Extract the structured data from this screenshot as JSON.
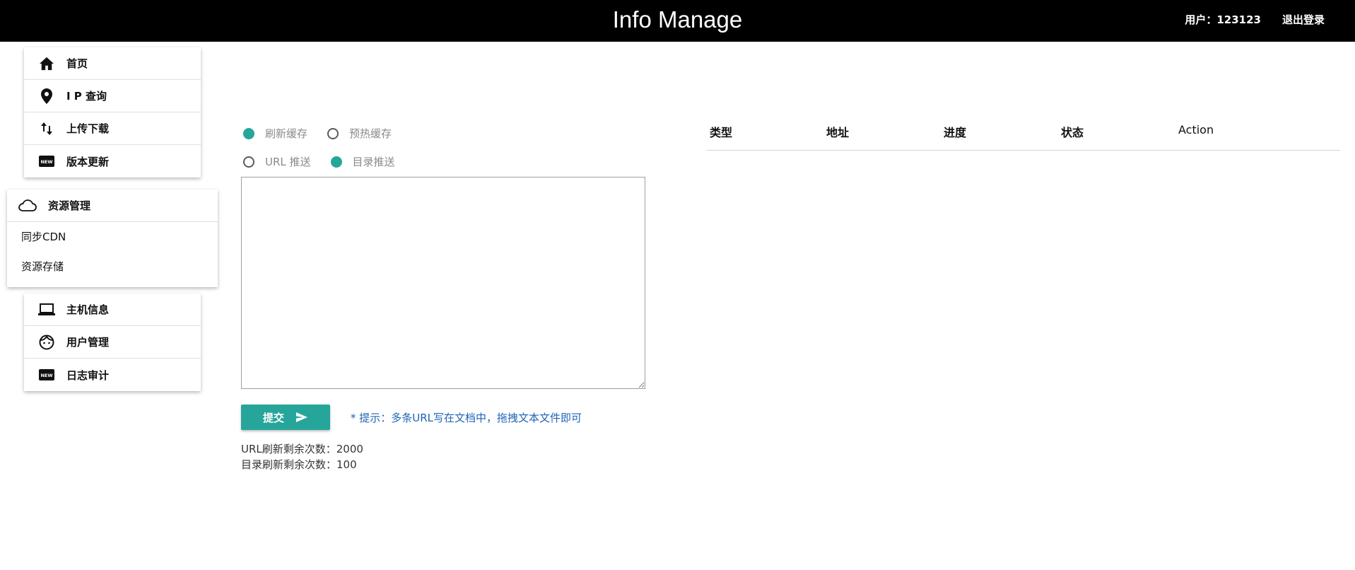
{
  "header": {
    "title": "Info Manage",
    "user": "用户：123123",
    "logout": "退出登录"
  },
  "sidebar": {
    "group1": [
      {
        "label": "首页",
        "icon": "home-icon"
      },
      {
        "label": "I P 查询",
        "icon": "location-pin-icon"
      },
      {
        "label": "上传下载",
        "icon": "swap-vertical-icon"
      },
      {
        "label": "版本更新",
        "icon": "new-badge-icon"
      }
    ],
    "resource": {
      "label": "资源管理",
      "icon": "cloud-icon",
      "subitems": [
        "同步CDN",
        "资源存储"
      ]
    },
    "group3": [
      {
        "label": "主机信息",
        "icon": "laptop-icon"
      },
      {
        "label": "用户管理",
        "icon": "face-icon"
      },
      {
        "label": "日志审计",
        "icon": "new-badge-icon"
      }
    ]
  },
  "form": {
    "radio_row1": [
      {
        "label": "刷新缓存",
        "checked": true
      },
      {
        "label": "预热缓存",
        "checked": false
      }
    ],
    "radio_row2": [
      {
        "label": "URL 推送",
        "checked": false
      },
      {
        "label": "目录推送",
        "checked": true
      }
    ],
    "textarea_value": "",
    "submit_label": "提交",
    "hint": "* 提示：多条URL写在文档中，拖拽文本文件即可",
    "url_quota": "URL刷新剩余次数：2000",
    "dir_quota": "目录刷新剩余次数：100"
  },
  "table": {
    "columns": [
      "类型",
      "地址",
      "进度",
      "状态",
      "Action"
    ]
  },
  "colors": {
    "accent": "#26a69a",
    "header_bg": "#000000",
    "hint": "#1e63b8"
  }
}
